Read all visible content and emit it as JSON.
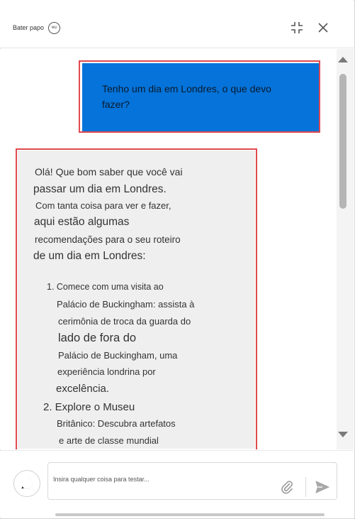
{
  "header": {
    "title": "Bater papo",
    "badge": "eu",
    "icons": {
      "collapse": "collapse-icon",
      "close": "close-icon"
    }
  },
  "chat": {
    "user_message": "Tenho um dia em Londres, o que devo fazer?",
    "bot_lines": [
      "Olá! Que bom saber que você vai",
      "passar um dia em Londres.",
      "Com tanta coisa para ver e fazer,",
      "aqui estão algumas",
      "recomendações para o seu roteiro",
      "de um dia em Londres:",
      "1. Comece com uma visita ao",
      "Palácio de Buckingham: assista à",
      "cerimônia de troca da guarda do",
      "lado de fora do",
      "Palácio de Buckingham, uma",
      "experiência londrina por",
      "excelência.",
      "2. Explore o Museu",
      "Britânico: Descubra artefatos",
      "e arte de classe mundial"
    ]
  },
  "composer": {
    "placeholder": "Insira qualquer coisa para testar...",
    "value": "",
    "icons": {
      "add": "add-comment-icon",
      "attach": "paperclip-icon",
      "send": "send-icon"
    }
  },
  "colors": {
    "user_bubble": "#0573d9",
    "bot_bubble": "#efefef",
    "highlight_outline": "#e04a4f"
  }
}
